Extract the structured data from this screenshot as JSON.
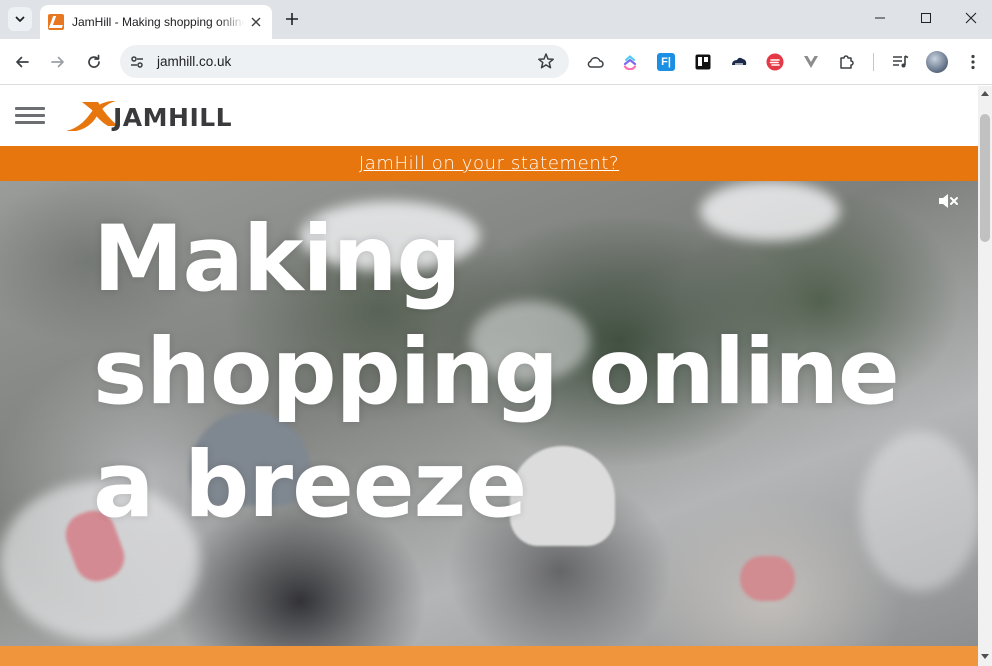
{
  "browser": {
    "tab_title": "JamHill - Making shopping online a breeze",
    "url": "jamhill.co.uk",
    "icons": {
      "tab_search": "chevron-down-icon",
      "tab_close": "close-icon",
      "new_tab": "plus-icon",
      "minimize": "minimize-icon",
      "maximize": "maximize-icon",
      "close_window": "close-icon",
      "back": "back-arrow-icon",
      "forward": "forward-arrow-icon",
      "reload": "reload-icon",
      "site_info": "tune-icon",
      "bookmark": "star-icon",
      "extensions": [
        "cloud-icon",
        "clickup-icon",
        "fi-icon",
        "trello-icon",
        "cloud-car-icon",
        "red-badge-icon",
        "vivaldi-icon",
        "puzzle-icon",
        "media-control-icon",
        "profile-avatar-icon",
        "more-menu-icon"
      ]
    },
    "ext_labels": {
      "fi": "F|"
    }
  },
  "site": {
    "logo_text": "JAMHILL",
    "banner_link": "JamHill on your statement?",
    "hero_lines": [
      "Making",
      "shopping online",
      "a breeze"
    ],
    "colors": {
      "brand_orange": "#e8760f",
      "logo_dark": "#3a3a3c",
      "bottom_bar": "#f0953c"
    }
  }
}
